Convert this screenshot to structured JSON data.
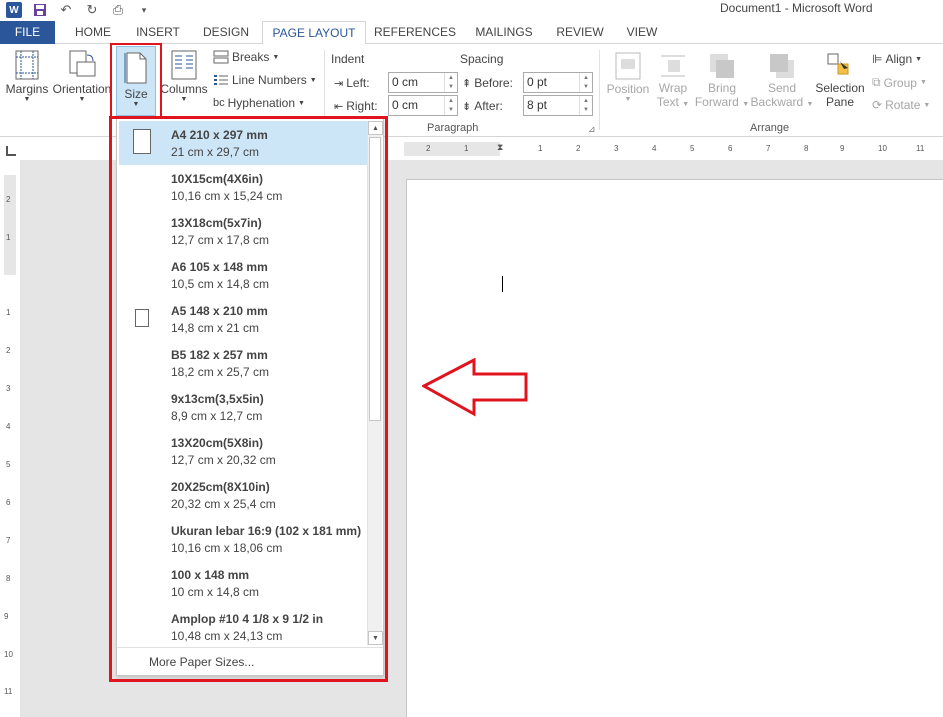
{
  "titlebar": {
    "title": "Document1 - Microsoft Word",
    "qat": [
      "word-icon",
      "save-icon",
      "undo-icon",
      "redo-icon",
      "print-preview-icon",
      "customize-icon"
    ]
  },
  "tabs": {
    "file": "FILE",
    "items": [
      "HOME",
      "INSERT",
      "DESIGN",
      "PAGE LAYOUT",
      "REFERENCES",
      "MAILINGS",
      "REVIEW",
      "VIEW"
    ],
    "active": "PAGE LAYOUT"
  },
  "ribbon": {
    "margins": "Margins",
    "orientation": "Orientation",
    "size": "Size",
    "columns": "Columns",
    "breaks": "Breaks",
    "line_numbers": "Line Numbers",
    "hyphenation": "Hyphenation",
    "indent": "Indent",
    "spacing": "Spacing",
    "left_label": "Left:",
    "right_label": "Right:",
    "before_label": "Before:",
    "after_label": "After:",
    "left_value": "0 cm",
    "right_value": "0 cm",
    "before_value": "0 pt",
    "after_value": "8 pt",
    "paragraph_group": "Paragraph",
    "position": "Position",
    "wrap_text_1": "Wrap",
    "wrap_text_2": "Text",
    "bring_forward_1": "Bring",
    "bring_forward_2": "Forward",
    "send_backward_1": "Send",
    "send_backward_2": "Backward",
    "selection_pane_1": "Selection",
    "selection_pane_2": "Pane",
    "align": "Align",
    "group": "Group",
    "rotate": "Rotate",
    "arrange_group": "Arrange"
  },
  "hruler_numbers": [
    "2",
    "1",
    "1",
    "2",
    "3",
    "4",
    "5",
    "6",
    "7",
    "8",
    "9",
    "10",
    "11"
  ],
  "vruler_numbers": [
    "2",
    "1",
    "1",
    "2",
    "3",
    "4",
    "5",
    "6",
    "7",
    "8",
    "9",
    "10",
    "11"
  ],
  "size_menu": {
    "items": [
      {
        "name": "A4 210 x 297 mm",
        "dims": "21 cm x 29,7 cm",
        "selected": true,
        "icon": "portrait"
      },
      {
        "name": "10X15cm(4X6in)",
        "dims": "10,16 cm x 15,24 cm"
      },
      {
        "name": "13X18cm(5x7in)",
        "dims": "12,7 cm x 17,8 cm"
      },
      {
        "name": "A6 105 x 148 mm",
        "dims": "10,5 cm x 14,8 cm"
      },
      {
        "name": "A5 148 x 210 mm",
        "dims": "14,8 cm x 21 cm",
        "icon": "small-portrait"
      },
      {
        "name": "B5 182 x 257 mm",
        "dims": "18,2 cm x 25,7 cm"
      },
      {
        "name": "9x13cm(3,5x5in)",
        "dims": "8,9 cm x 12,7 cm"
      },
      {
        "name": "13X20cm(5X8in)",
        "dims": "12,7 cm x 20,32 cm"
      },
      {
        "name": "20X25cm(8X10in)",
        "dims": "20,32 cm x 25,4 cm"
      },
      {
        "name": "Ukuran lebar 16:9 (102 x 181 mm)",
        "dims": "10,16 cm x 18,06 cm"
      },
      {
        "name": "100 x 148 mm",
        "dims": "10 cm x 14,8 cm"
      },
      {
        "name": "Amplop #10 4 1/8 x 9 1/2 in",
        "dims": "10,48 cm x 24,13 cm"
      }
    ],
    "more": "More Paper Sizes..."
  },
  "colors": {
    "accent": "#2b579a",
    "highlight": "#cde6f7",
    "annotation": "#e0141e"
  }
}
